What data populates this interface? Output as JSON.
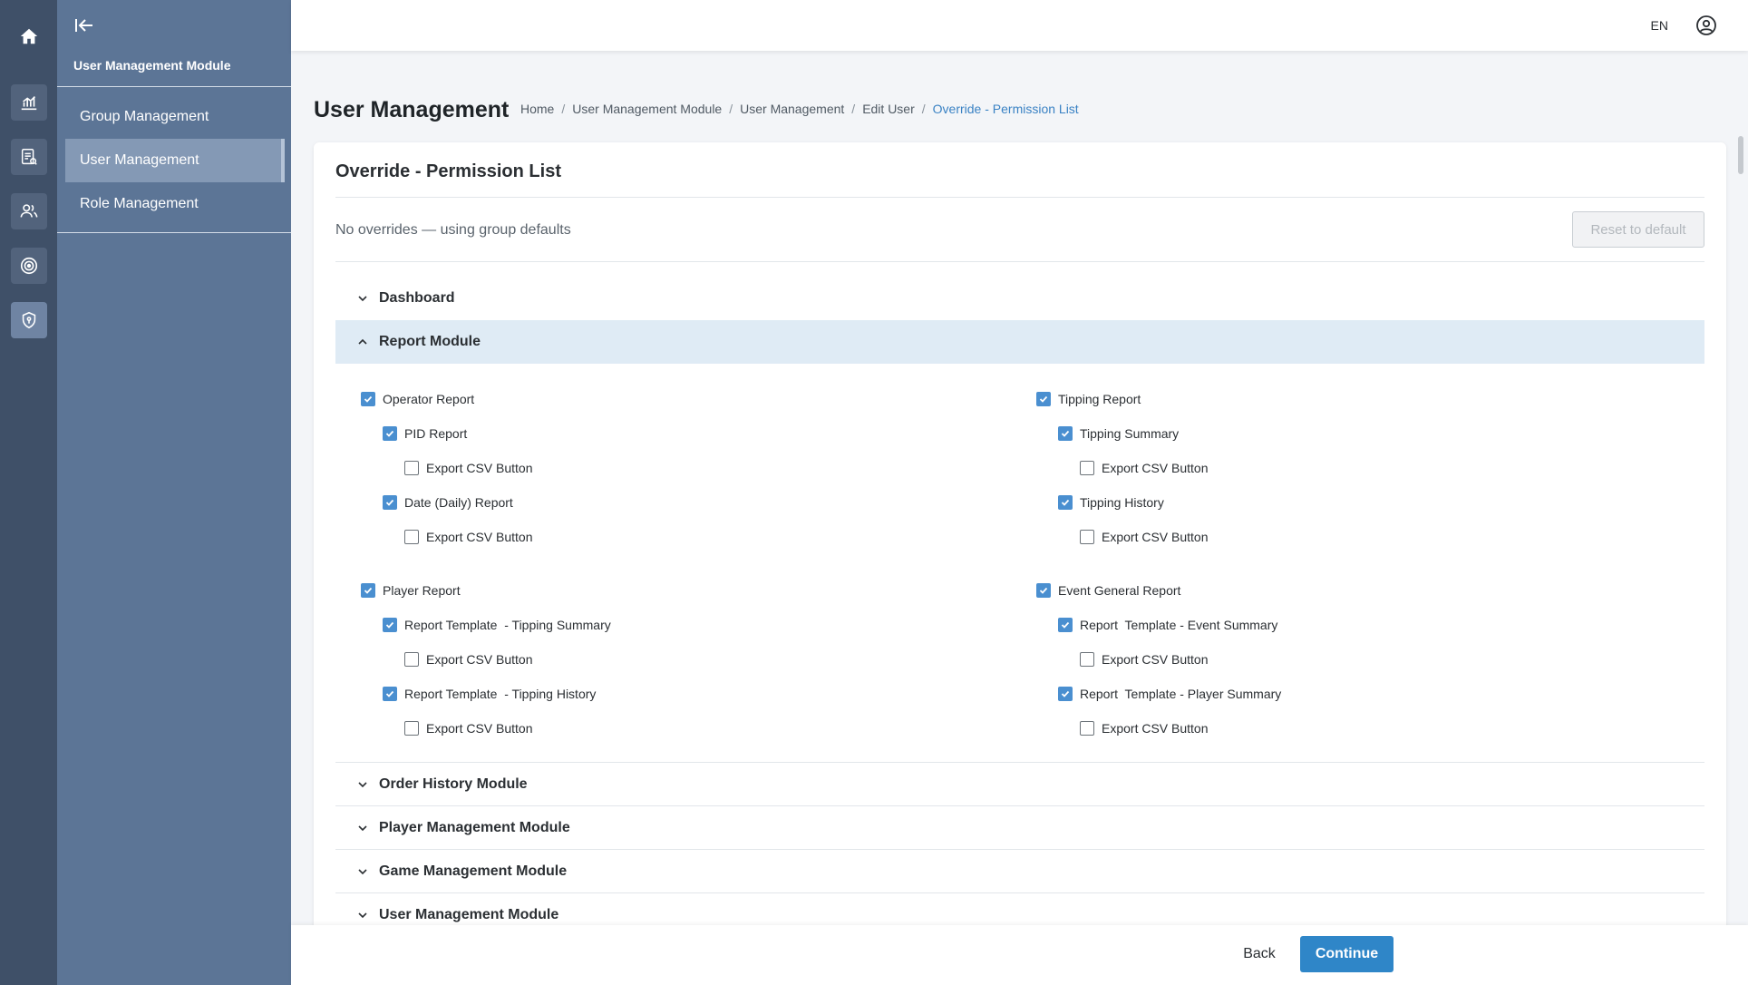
{
  "rail": {
    "items": [
      {
        "icon": "home-icon"
      },
      {
        "icon": "report-chart-icon"
      },
      {
        "icon": "document-search-icon"
      },
      {
        "icon": "users-icon"
      },
      {
        "icon": "target-icon"
      },
      {
        "icon": "shield-icon",
        "active": true
      }
    ]
  },
  "subnav": {
    "title": "User Management Module",
    "items": [
      {
        "label": "Group Management"
      },
      {
        "label": "User Management",
        "active": true
      },
      {
        "label": "Role Management"
      }
    ]
  },
  "topbar": {
    "language": "EN"
  },
  "page": {
    "title": "User Management",
    "breadcrumb": [
      "Home",
      "User Management Module",
      "User Management",
      "Edit User",
      "Override - Permission List"
    ]
  },
  "card": {
    "title": "Override - Permission List",
    "status": "No overrides — using group defaults",
    "reset_label": "Reset to default"
  },
  "sections": {
    "dashboard": "Dashboard",
    "report_module": "Report Module",
    "order_history": "Order History Module",
    "player_management": "Player Management Module",
    "game_management": "Game Management Module",
    "user_management": "User Management Module"
  },
  "report_permissions": {
    "left": [
      {
        "label": "Operator Report",
        "checked": true
      },
      {
        "label": "PID Report",
        "checked": true
      },
      {
        "label": "Export CSV Button",
        "checked": false
      },
      {
        "label": "Date (Daily) Report",
        "checked": true
      },
      {
        "label": "Export CSV Button",
        "checked": false
      },
      {
        "label": "Player Report",
        "checked": true
      },
      {
        "label": "Report Template  - Tipping Summary",
        "checked": true
      },
      {
        "label": "Export CSV Button",
        "checked": false
      },
      {
        "label": "Report Template  - Tipping History",
        "checked": true
      },
      {
        "label": "Export CSV Button",
        "checked": false
      }
    ],
    "right": [
      {
        "label": "Tipping Report",
        "checked": true
      },
      {
        "label": "Tipping Summary",
        "checked": true
      },
      {
        "label": "Export CSV Button",
        "checked": false
      },
      {
        "label": "Tipping History",
        "checked": true
      },
      {
        "label": "Export CSV Button",
        "checked": false
      },
      {
        "label": "Event General Report",
        "checked": true
      },
      {
        "label": "Report  Template - Event Summary",
        "checked": true
      },
      {
        "label": "Export CSV Button",
        "checked": false
      },
      {
        "label": "Report  Template - Player Summary",
        "checked": true
      },
      {
        "label": "Export CSV Button",
        "checked": false
      }
    ]
  },
  "footer": {
    "back_label": "Back",
    "continue_label": "Continue"
  },
  "colors": {
    "rail_bg": "#3f5068",
    "sidebar_bg": "#5c7596",
    "accent": "#2f86c8",
    "checkbox_on": "#4a8fd0",
    "section_open_bg": "#dfebf5"
  }
}
